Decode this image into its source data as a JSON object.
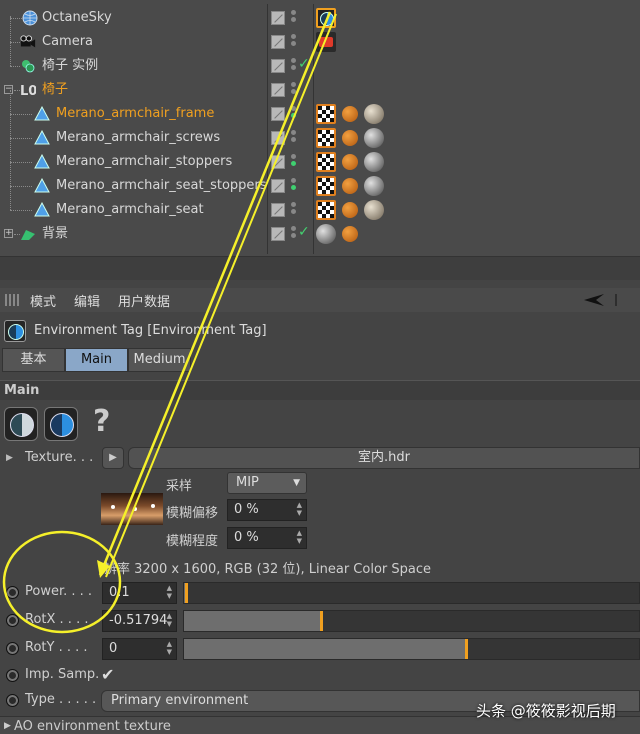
{
  "objects": [
    {
      "label": "OctaneSky",
      "icon": "globe-icon"
    },
    {
      "label": "Camera",
      "icon": "camera-icon"
    },
    {
      "label": "椅子 实例",
      "icon": "instance-icon"
    },
    {
      "label": "椅子",
      "icon": "null-object-icon",
      "active": true
    },
    {
      "label": "Merano_armchair_frame",
      "icon": "polygon-object-icon",
      "active": true
    },
    {
      "label": "Merano_armchair_screws",
      "icon": "polygon-object-icon"
    },
    {
      "label": "Merano_armchair_stoppers",
      "icon": "polygon-object-icon"
    },
    {
      "label": "Merano_armchair_seat_stoppers",
      "icon": "polygon-object-icon"
    },
    {
      "label": "Merano_armchair_seat",
      "icon": "polygon-object-icon"
    },
    {
      "label": "背景",
      "icon": "background-icon"
    }
  ],
  "menubar": {
    "mode": "模式",
    "edit": "编辑",
    "user_data": "用户数据"
  },
  "header": {
    "title": "Environment Tag [Environment Tag]"
  },
  "tabs": [
    "基本",
    "Main",
    "Medium"
  ],
  "active_tab": "Main",
  "section": "Main",
  "texture": {
    "label": "Texture. . .",
    "file": "室内.hdr"
  },
  "sampling": {
    "label": "采样",
    "value": "MIP"
  },
  "blur_offset": {
    "label": "模糊偏移",
    "value": "0 %"
  },
  "blur_degree": {
    "label": "模糊程度",
    "value": "0 %"
  },
  "info_text": "辨率 3200 x 1600, RGB (32 位), Linear Color Space",
  "params": {
    "power": {
      "label": "Power. . . .",
      "value": "0.1",
      "level": 0.005
    },
    "rotx": {
      "label": "RotX . . . .",
      "value": "-0.51794",
      "level": 0.3
    },
    "roty": {
      "label": "RotY . . . .",
      "value": "0",
      "level": 0.62
    },
    "imp_samp": {
      "label": "Imp. Samp.",
      "checked": true
    },
    "type": {
      "label": "Type . . . . .",
      "value": "Primary environment"
    }
  },
  "ao_section": "AO environment texture",
  "watermark": "头条 @筱筱影视后期",
  "colors": {
    "accent": "#f0a020",
    "tab_active": "#8aa7c8",
    "annotation": "#f5f02a"
  }
}
